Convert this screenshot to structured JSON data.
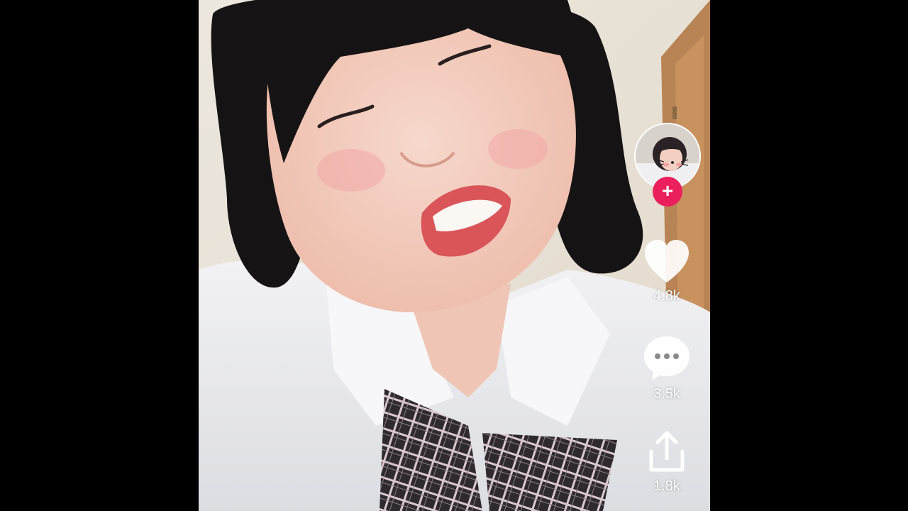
{
  "colors": {
    "follow_accent": "#ea1f5c",
    "icon_fill": "#ffffff",
    "background": "#000000"
  },
  "actions": {
    "like": {
      "icon": "heart-icon",
      "count": "4.8k"
    },
    "comment": {
      "icon": "comment-bubble-icon",
      "count": "3.5k"
    },
    "share": {
      "icon": "share-arrow-icon",
      "count": "1.8k"
    }
  },
  "creator": {
    "avatar_icon": "creator-avatar",
    "follow_icon": "plus-icon",
    "follow_symbol": "+"
  }
}
